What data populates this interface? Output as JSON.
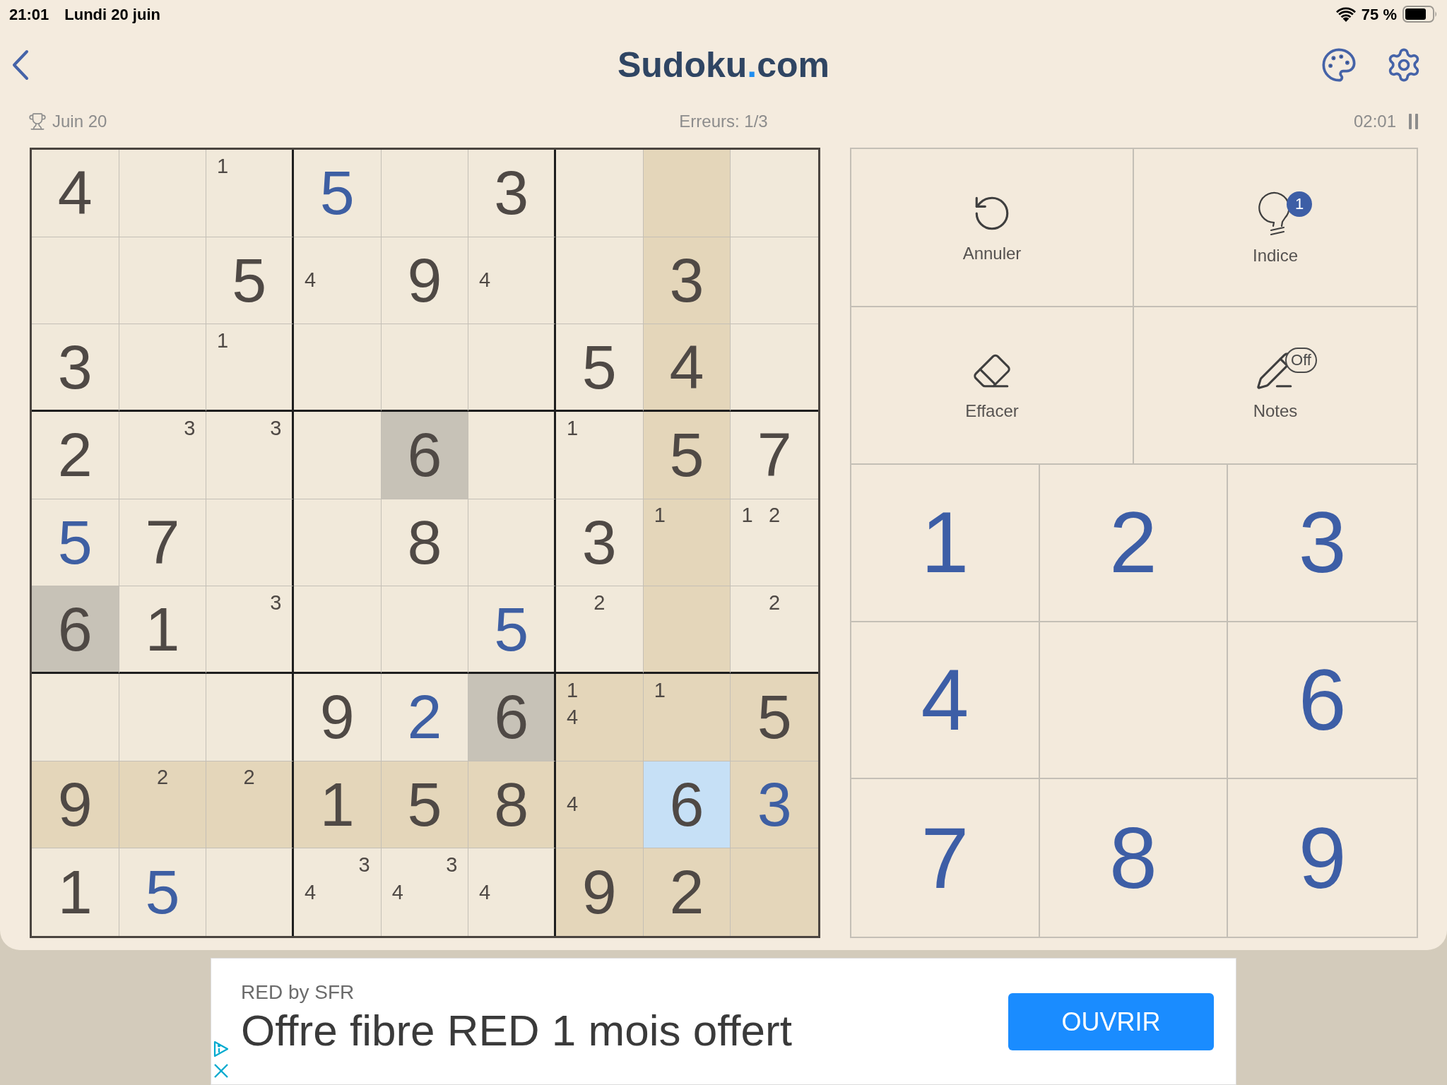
{
  "status_bar": {
    "time": "21:01",
    "date": "Lundi 20 juin",
    "battery": "75 %"
  },
  "header": {
    "logo": {
      "name": "Sudoku",
      "dot": ".",
      "domain": "com"
    }
  },
  "info": {
    "challenge": "Juin 20",
    "errors": "Erreurs: 1/3",
    "timer": "02:01"
  },
  "grid": {
    "rows": [
      [
        {
          "kind": "given",
          "value": "4",
          "selected": false,
          "highlighted": false,
          "same_digit": false
        },
        {
          "kind": "empty",
          "selected": false,
          "highlighted": false,
          "same_digit": false
        },
        {
          "kind": "notes",
          "notes": {
            "top-left": "1"
          },
          "selected": false,
          "highlighted": false,
          "same_digit": false
        },
        {
          "kind": "entered",
          "value": "5",
          "selected": false,
          "highlighted": false,
          "same_digit": false
        },
        {
          "kind": "empty",
          "selected": false,
          "highlighted": false,
          "same_digit": false
        },
        {
          "kind": "given",
          "value": "3",
          "selected": false,
          "highlighted": false,
          "same_digit": false
        },
        {
          "kind": "empty",
          "selected": false,
          "highlighted": false,
          "same_digit": false
        },
        {
          "kind": "empty",
          "selected": false,
          "highlighted": true,
          "same_digit": false
        },
        {
          "kind": "empty",
          "selected": false,
          "highlighted": false,
          "same_digit": false
        }
      ],
      [
        {
          "kind": "empty",
          "selected": false,
          "highlighted": false,
          "same_digit": false
        },
        {
          "kind": "empty",
          "selected": false,
          "highlighted": false,
          "same_digit": false
        },
        {
          "kind": "given",
          "value": "5",
          "selected": false,
          "highlighted": false,
          "same_digit": false
        },
        {
          "kind": "notes",
          "notes": {
            "middle-left": "4"
          },
          "selected": false,
          "highlighted": false,
          "same_digit": false
        },
        {
          "kind": "given",
          "value": "9",
          "selected": false,
          "highlighted": false,
          "same_digit": false
        },
        {
          "kind": "notes",
          "notes": {
            "middle-left": "4"
          },
          "selected": false,
          "highlighted": false,
          "same_digit": false
        },
        {
          "kind": "empty",
          "selected": false,
          "highlighted": false,
          "same_digit": false
        },
        {
          "kind": "given",
          "value": "3",
          "selected": false,
          "highlighted": true,
          "same_digit": false
        },
        {
          "kind": "empty",
          "selected": false,
          "highlighted": false,
          "same_digit": false
        }
      ],
      [
        {
          "kind": "given",
          "value": "3",
          "selected": false,
          "highlighted": false,
          "same_digit": false
        },
        {
          "kind": "empty",
          "selected": false,
          "highlighted": false,
          "same_digit": false
        },
        {
          "kind": "notes",
          "notes": {
            "top-left": "1"
          },
          "selected": false,
          "highlighted": false,
          "same_digit": false
        },
        {
          "kind": "empty",
          "selected": false,
          "highlighted": false,
          "same_digit": false
        },
        {
          "kind": "empty",
          "selected": false,
          "highlighted": false,
          "same_digit": false
        },
        {
          "kind": "empty",
          "selected": false,
          "highlighted": false,
          "same_digit": false
        },
        {
          "kind": "given",
          "value": "5",
          "selected": false,
          "highlighted": false,
          "same_digit": false
        },
        {
          "kind": "given",
          "value": "4",
          "selected": false,
          "highlighted": true,
          "same_digit": false
        },
        {
          "kind": "empty",
          "selected": false,
          "highlighted": false,
          "same_digit": false
        }
      ],
      [
        {
          "kind": "given",
          "value": "2",
          "selected": false,
          "highlighted": false,
          "same_digit": false
        },
        {
          "kind": "notes",
          "notes": {
            "top-right": "3"
          },
          "selected": false,
          "highlighted": false,
          "same_digit": false
        },
        {
          "kind": "notes",
          "notes": {
            "top-right": "3"
          },
          "selected": false,
          "highlighted": false,
          "same_digit": false
        },
        {
          "kind": "empty",
          "selected": false,
          "highlighted": false,
          "same_digit": false
        },
        {
          "kind": "given",
          "value": "6",
          "selected": false,
          "highlighted": false,
          "same_digit": true
        },
        {
          "kind": "empty",
          "selected": false,
          "highlighted": false,
          "same_digit": false
        },
        {
          "kind": "notes",
          "notes": {
            "top-left": "1"
          },
          "selected": false,
          "highlighted": false,
          "same_digit": false
        },
        {
          "kind": "given",
          "value": "5",
          "selected": false,
          "highlighted": true,
          "same_digit": false
        },
        {
          "kind": "given",
          "value": "7",
          "selected": false,
          "highlighted": false,
          "same_digit": false
        }
      ],
      [
        {
          "kind": "entered",
          "value": "5",
          "selected": false,
          "highlighted": false,
          "same_digit": false
        },
        {
          "kind": "given",
          "value": "7",
          "selected": false,
          "highlighted": false,
          "same_digit": false
        },
        {
          "kind": "empty",
          "selected": false,
          "highlighted": false,
          "same_digit": false
        },
        {
          "kind": "empty",
          "selected": false,
          "highlighted": false,
          "same_digit": false
        },
        {
          "kind": "given",
          "value": "8",
          "selected": false,
          "highlighted": false,
          "same_digit": false
        },
        {
          "kind": "empty",
          "selected": false,
          "highlighted": false,
          "same_digit": false
        },
        {
          "kind": "given",
          "value": "3",
          "selected": false,
          "highlighted": false,
          "same_digit": false
        },
        {
          "kind": "notes",
          "notes": {
            "top-left": "1"
          },
          "selected": false,
          "highlighted": true,
          "same_digit": false
        },
        {
          "kind": "notes",
          "notes": {
            "top-left": "1",
            "top-center": "2"
          },
          "selected": false,
          "highlighted": false,
          "same_digit": false
        }
      ],
      [
        {
          "kind": "given",
          "value": "6",
          "selected": false,
          "highlighted": false,
          "same_digit": true
        },
        {
          "kind": "given",
          "value": "1",
          "selected": false,
          "highlighted": false,
          "same_digit": false
        },
        {
          "kind": "notes",
          "notes": {
            "top-right": "3"
          },
          "selected": false,
          "highlighted": false,
          "same_digit": false
        },
        {
          "kind": "empty",
          "selected": false,
          "highlighted": false,
          "same_digit": false
        },
        {
          "kind": "empty",
          "selected": false,
          "highlighted": false,
          "same_digit": false
        },
        {
          "kind": "entered",
          "value": "5",
          "selected": false,
          "highlighted": false,
          "same_digit": false
        },
        {
          "kind": "notes",
          "notes": {
            "top-center": "2"
          },
          "selected": false,
          "highlighted": false,
          "same_digit": false
        },
        {
          "kind": "empty",
          "selected": false,
          "highlighted": true,
          "same_digit": false
        },
        {
          "kind": "notes",
          "notes": {
            "top-center": "2"
          },
          "selected": false,
          "highlighted": false,
          "same_digit": false
        }
      ],
      [
        {
          "kind": "empty",
          "selected": false,
          "highlighted": false,
          "same_digit": false
        },
        {
          "kind": "empty",
          "selected": false,
          "highlighted": false,
          "same_digit": false
        },
        {
          "kind": "empty",
          "selected": false,
          "highlighted": false,
          "same_digit": false
        },
        {
          "kind": "given",
          "value": "9",
          "selected": false,
          "highlighted": false,
          "same_digit": false
        },
        {
          "kind": "entered",
          "value": "2",
          "selected": false,
          "highlighted": false,
          "same_digit": false
        },
        {
          "kind": "given",
          "value": "6",
          "selected": false,
          "highlighted": false,
          "same_digit": true
        },
        {
          "kind": "notes",
          "notes": {
            "top-left": "1",
            "middle-left": "4"
          },
          "selected": false,
          "highlighted": true,
          "same_digit": false
        },
        {
          "kind": "notes",
          "notes": {
            "top-left": "1"
          },
          "selected": false,
          "highlighted": true,
          "same_digit": false
        },
        {
          "kind": "given",
          "value": "5",
          "selected": false,
          "highlighted": true,
          "same_digit": false
        }
      ],
      [
        {
          "kind": "given",
          "value": "9",
          "selected": false,
          "highlighted": true,
          "same_digit": false
        },
        {
          "kind": "notes",
          "notes": {
            "top-center": "2"
          },
          "selected": false,
          "highlighted": true,
          "same_digit": false
        },
        {
          "kind": "notes",
          "notes": {
            "top-center": "2"
          },
          "selected": false,
          "highlighted": true,
          "same_digit": false
        },
        {
          "kind": "given",
          "value": "1",
          "selected": false,
          "highlighted": true,
          "same_digit": false
        },
        {
          "kind": "given",
          "value": "5",
          "selected": false,
          "highlighted": true,
          "same_digit": false
        },
        {
          "kind": "given",
          "value": "8",
          "selected": false,
          "highlighted": true,
          "same_digit": false
        },
        {
          "kind": "notes",
          "notes": {
            "middle-left": "4"
          },
          "selected": false,
          "highlighted": true,
          "same_digit": false
        },
        {
          "kind": "given",
          "value": "6",
          "selected": true,
          "highlighted": false,
          "same_digit": false
        },
        {
          "kind": "entered",
          "value": "3",
          "selected": false,
          "highlighted": true,
          "same_digit": false
        }
      ],
      [
        {
          "kind": "given",
          "value": "1",
          "selected": false,
          "highlighted": false,
          "same_digit": false
        },
        {
          "kind": "entered",
          "value": "5",
          "selected": false,
          "highlighted": false,
          "same_digit": false
        },
        {
          "kind": "empty",
          "selected": false,
          "highlighted": false,
          "same_digit": false
        },
        {
          "kind": "notes",
          "notes": {
            "top-right": "3",
            "middle-left": "4"
          },
          "selected": false,
          "highlighted": false,
          "same_digit": false
        },
        {
          "kind": "notes",
          "notes": {
            "top-right": "3",
            "middle-left": "4"
          },
          "selected": false,
          "highlighted": false,
          "same_digit": false
        },
        {
          "kind": "notes",
          "notes": {
            "middle-left": "4"
          },
          "selected": false,
          "highlighted": false,
          "same_digit": false
        },
        {
          "kind": "given",
          "value": "9",
          "selected": false,
          "highlighted": true,
          "same_digit": false
        },
        {
          "kind": "given",
          "value": "2",
          "selected": false,
          "highlighted": true,
          "same_digit": false
        },
        {
          "kind": "empty",
          "selected": false,
          "highlighted": true,
          "same_digit": false
        }
      ]
    ]
  },
  "actions": [
    {
      "kind": "undo",
      "label": "Annuler"
    },
    {
      "kind": "hint",
      "label": "Indice",
      "badge": "1"
    },
    {
      "kind": "erase",
      "label": "Effacer"
    },
    {
      "kind": "notes",
      "label": "Notes",
      "toggle": "Off",
      "on": false
    }
  ],
  "keypad": [
    {
      "kind": "digit",
      "digit": "1"
    },
    {
      "kind": "digit",
      "digit": "2"
    },
    {
      "kind": "digit",
      "digit": "3"
    },
    {
      "kind": "digit",
      "digit": "4"
    },
    {
      "kind": "blank"
    },
    {
      "kind": "digit",
      "digit": "6"
    },
    {
      "kind": "digit",
      "digit": "7"
    },
    {
      "kind": "digit",
      "digit": "8"
    },
    {
      "kind": "digit",
      "digit": "9"
    }
  ],
  "ad": {
    "advertiser": "RED by SFR",
    "headline": "Offre fibre RED 1 mois offert",
    "button": "OUVRIR"
  }
}
